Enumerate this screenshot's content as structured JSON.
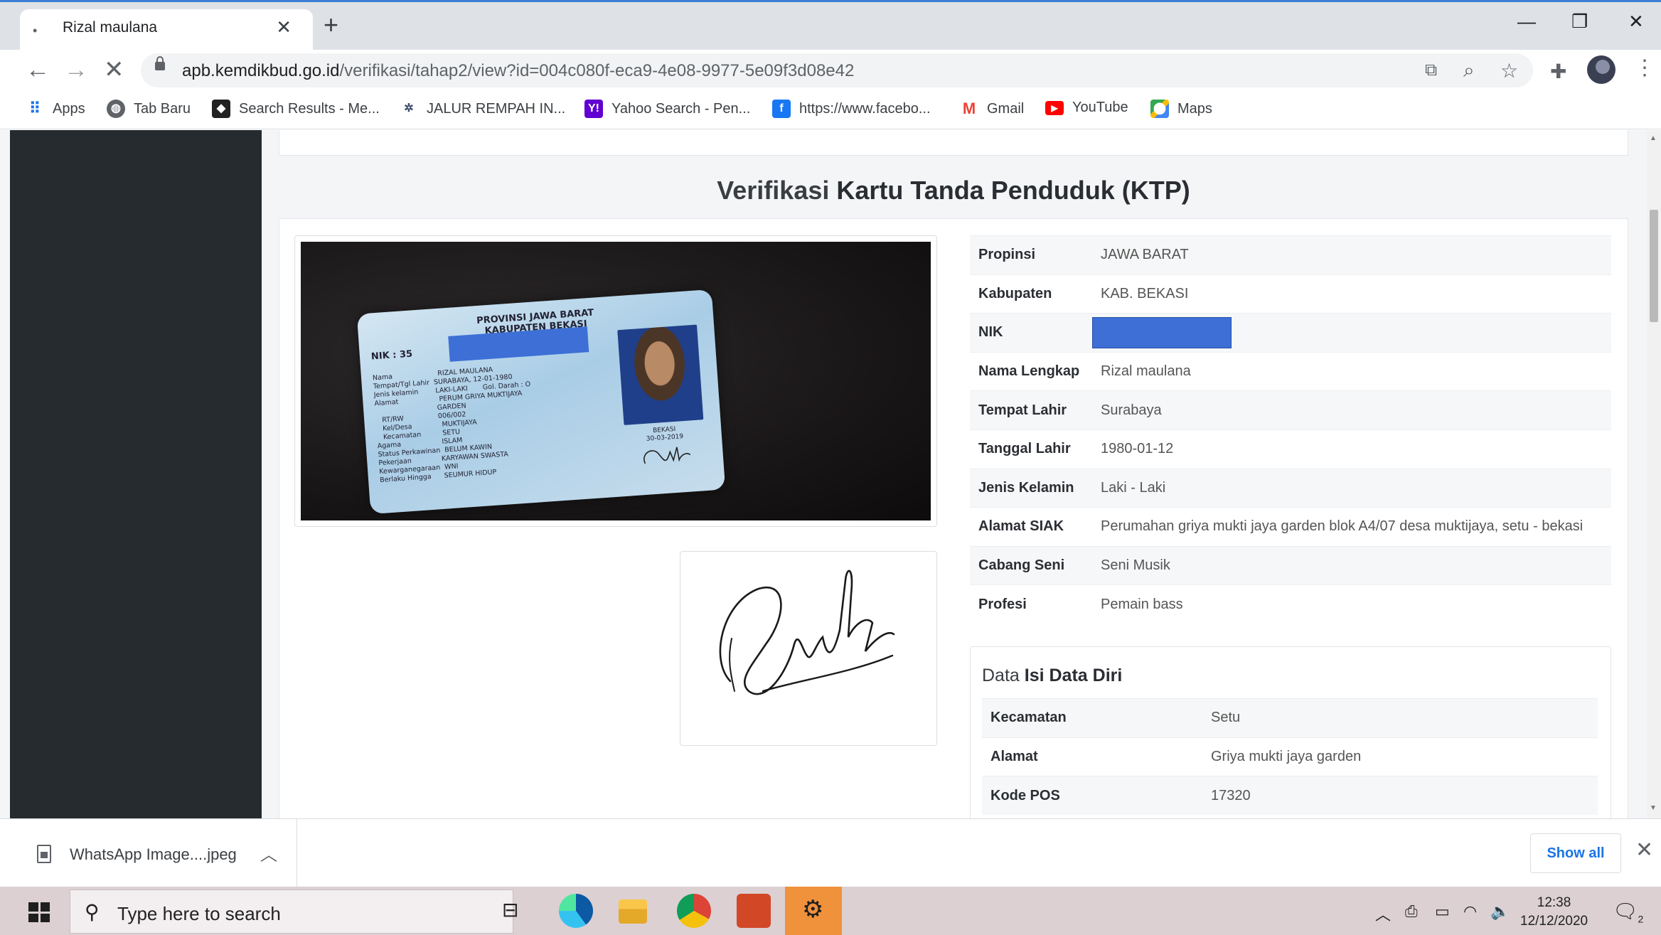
{
  "browser": {
    "tab_title": "Rizal maulana",
    "tab_loading_icon": "•",
    "url_host": "apb.kemdikbud.go.id",
    "url_path": "/verifikasi/tahap2/view?id=004c080f-eca9-4e08-9977-5e09f3d08e42",
    "bookmarks": [
      {
        "label": "Apps",
        "icon": "apps-grid-icon"
      },
      {
        "label": "Tab Baru",
        "icon": "globe-icon"
      },
      {
        "label": "Search Results - Me...",
        "icon": "site-icon"
      },
      {
        "label": "JALUR REMPAH IN...",
        "icon": "site-icon"
      },
      {
        "label": "Yahoo Search - Pen...",
        "icon": "yahoo-icon"
      },
      {
        "label": "https://www.facebo...",
        "icon": "facebook-icon"
      },
      {
        "label": "Gmail",
        "icon": "gmail-icon"
      },
      {
        "label": "YouTube",
        "icon": "youtube-icon"
      },
      {
        "label": "Maps",
        "icon": "maps-icon"
      }
    ]
  },
  "page": {
    "title_prefix": "Verifikasi",
    "title_bold": "Kartu Tanda Penduduk (KTP)",
    "ktp_card": {
      "header_line1": "PROVINSI JAWA BARAT",
      "header_line2": "KABUPATEN BEKASI",
      "nik_label": "NIK       : 35",
      "fields": "Nama                     RIZAL MAULANA\nTempat/Tgl Lahir  SURABAYA, 12-01-1980\nJenis kelamin        LAKI-LAKI       Gol. Darah : O\nAlamat                   PERUM GRIYA MUKTIJAYA\n                             GARDEN\n   RT/RW                006/002\n   Kel/Desa              MUKTIJAYA\n   Kecamatan          SETU\nAgama                   ISLAM\nStatus Perkawinan  BELUM KAWIN\nPekerjaan              KARYAWAN SWASTA\nKewarganegaraan  WNI\nBerlaku Hingga      SEUMUR HIDUP",
      "sign_place": "BEKASI",
      "sign_date": "30-03-2019"
    },
    "info": [
      {
        "label": "Propinsi",
        "value": "JAWA BARAT"
      },
      {
        "label": "Kabupaten",
        "value": "KAB. BEKASI"
      },
      {
        "label": "NIK",
        "value": ""
      },
      {
        "label": "Nama Lengkap",
        "value": "Rizal maulana"
      },
      {
        "label": "Tempat Lahir",
        "value": "Surabaya"
      },
      {
        "label": "Tanggal Lahir",
        "value": "1980-01-12"
      },
      {
        "label": "Jenis Kelamin",
        "value": "Laki - Laki"
      },
      {
        "label": "Alamat SIAK",
        "value": "Perumahan griya mukti jaya garden blok A4/07 desa muktijaya, setu - bekasi"
      },
      {
        "label": "Cabang Seni",
        "value": "Seni Musik"
      },
      {
        "label": "Profesi",
        "value": "Pemain bass"
      }
    ],
    "data_diri": {
      "title_prefix": "Data",
      "title_bold": "Isi Data Diri",
      "rows": [
        {
          "label": "Kecamatan",
          "value": "Setu"
        },
        {
          "label": "Alamat",
          "value": "Griya mukti jaya garden"
        },
        {
          "label": "Kode POS",
          "value": "17320"
        }
      ]
    }
  },
  "downloads": {
    "file_name": "WhatsApp Image....jpeg",
    "show_all": "Show all"
  },
  "taskbar": {
    "search_placeholder": "Type here to search",
    "time": "12:38",
    "date": "12/12/2020",
    "notification_count": "2"
  },
  "colors": {
    "redaction": "#3d6fd6",
    "sidebar": "#262b30",
    "accent_link": "#1a73e8",
    "active_taskbar_app": "#f0913c"
  }
}
